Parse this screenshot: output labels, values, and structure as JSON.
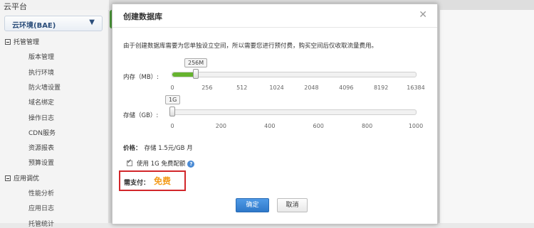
{
  "background": {
    "platform_title": "云平台",
    "env_selector": {
      "label": "云环境(BAE)"
    },
    "groups": [
      {
        "label": "托管管理",
        "items": [
          "版本管理",
          "执行环境",
          "防火墙设置",
          "域名绑定",
          "操作日志",
          "CDN服务",
          "资源报表",
          "预算设置"
        ]
      },
      {
        "label": "应用调优",
        "items": [
          "性能分析",
          "应用日志",
          "托管统计"
        ]
      }
    ]
  },
  "dialog": {
    "title": "创建数据库",
    "notice": "由于创建数据库需要为您单独设立空间，所以需要您进行预付费，购买空间后仅收取流量费用。",
    "memory": {
      "label": "内存（MB）:",
      "value_label": "256M",
      "value": 256,
      "ticks": [
        "0",
        "256",
        "512",
        "1024",
        "2048",
        "4096",
        "8192",
        "16384"
      ]
    },
    "storage": {
      "label": "存储（GB）:",
      "value_label": "1G",
      "value": 1,
      "ticks": [
        "0",
        "200",
        "400",
        "600",
        "800",
        "1000"
      ]
    },
    "price": {
      "label": "价格：",
      "value": "存储 1.5元/GB 月"
    },
    "free_quota": {
      "label": "使用 1G 免费配额",
      "checked": true
    },
    "payment": {
      "label": "需支付：",
      "value": "免费"
    },
    "ok_label": "确定",
    "cancel_label": "取消"
  },
  "colors": {
    "slider_fill": "#66b32e",
    "pay_box_border": "#d2262a",
    "pay_value": "#f39b1a",
    "primary_button": "#2e78c9"
  }
}
